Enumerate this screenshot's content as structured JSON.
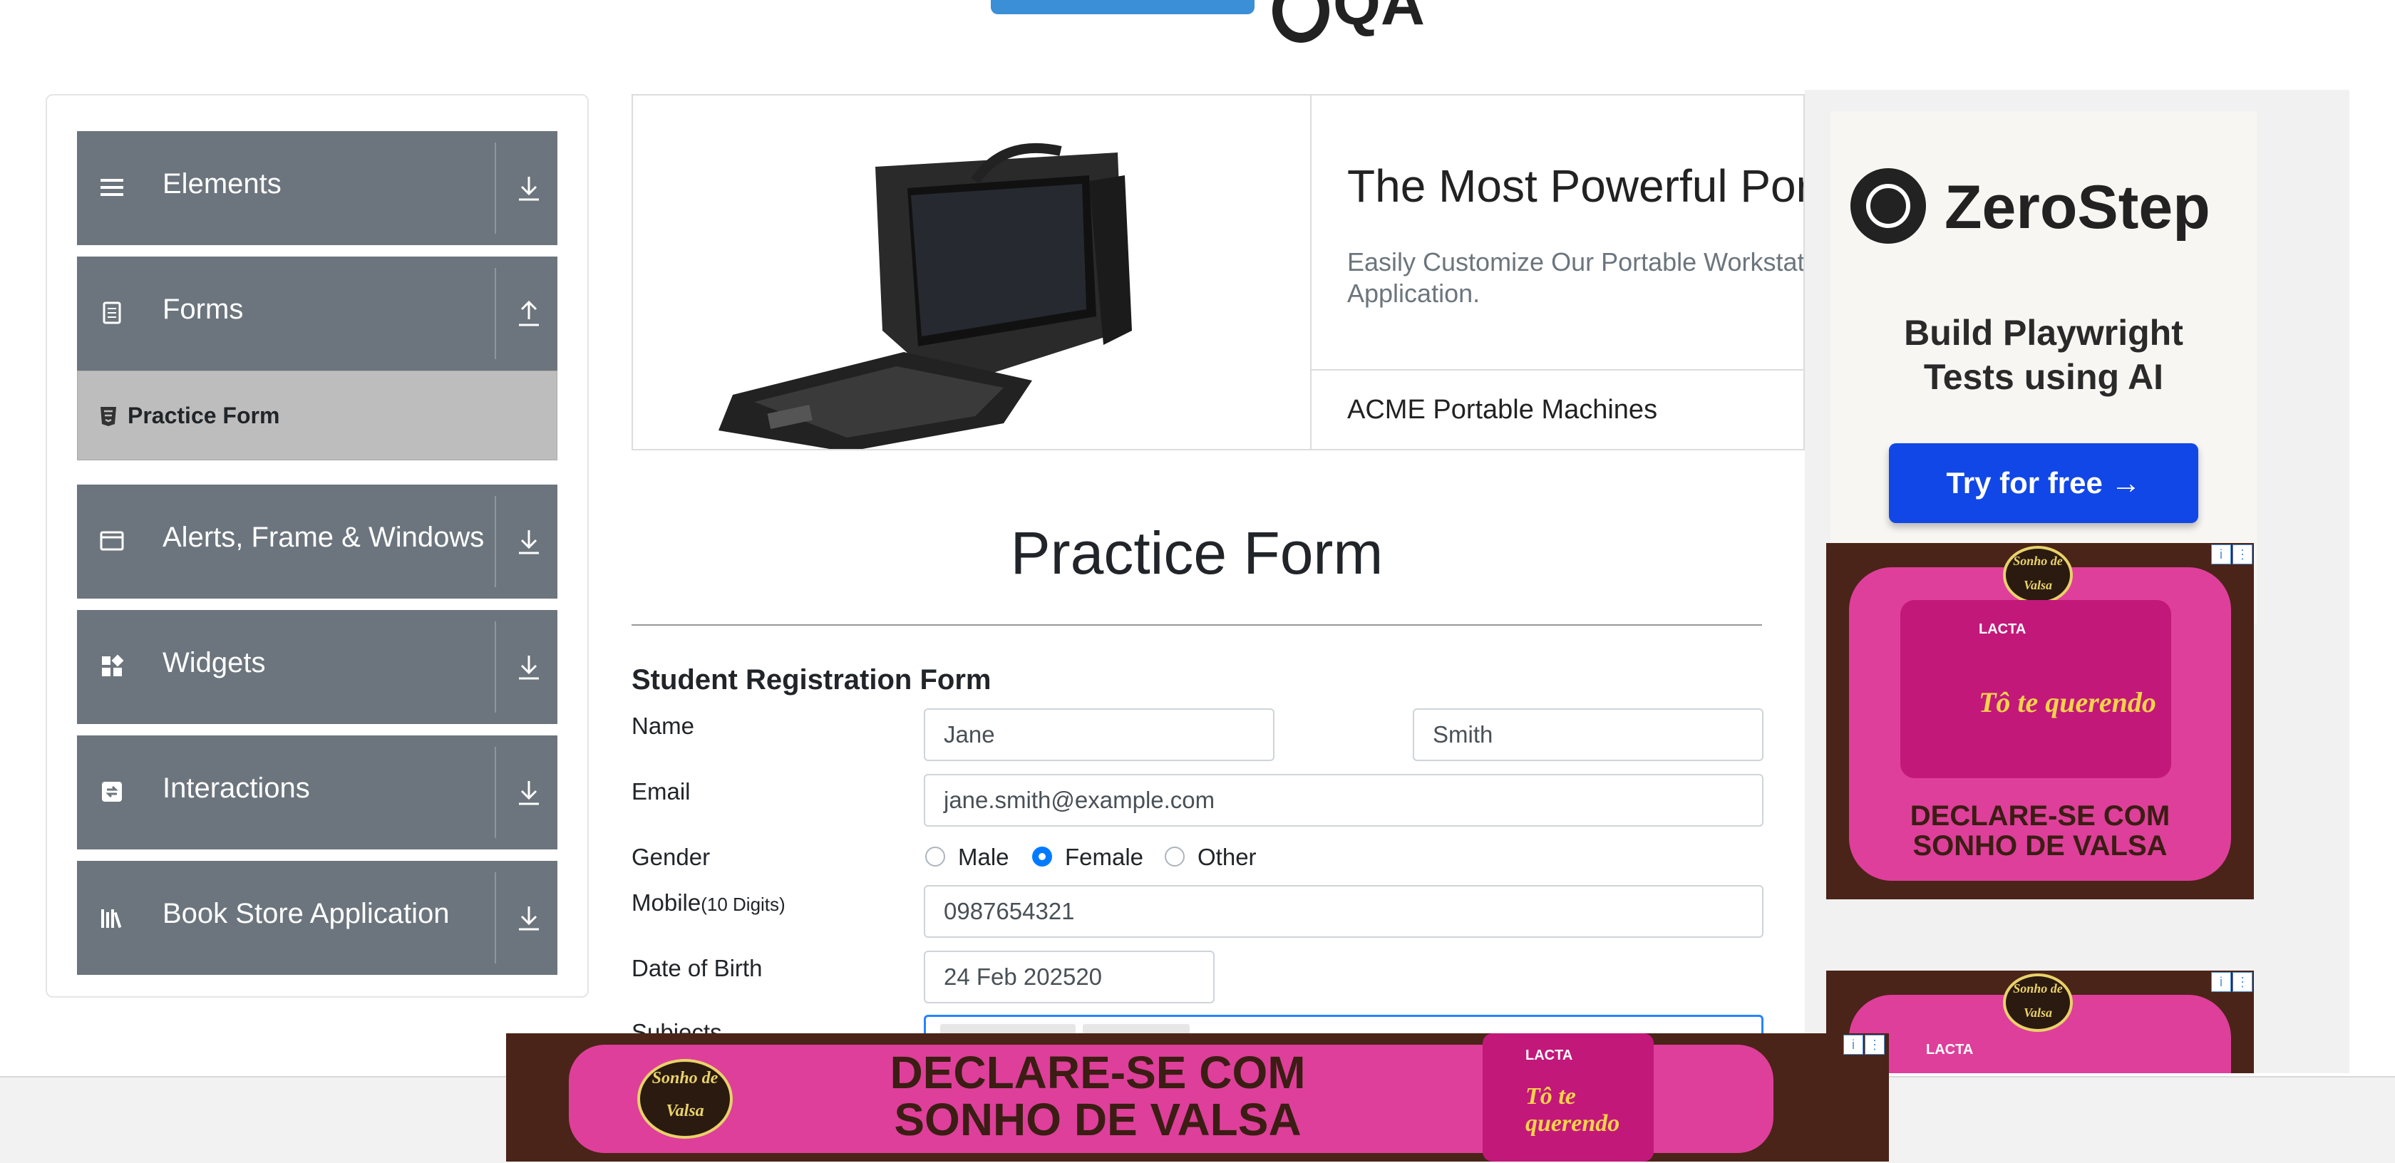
{
  "colors": {
    "sidebar_group_bg": "#6c757d",
    "active_item_bg": "#bdbdbd",
    "radio_checked": "#007bff",
    "ad_button": "#1147e6",
    "ad_pink": "#de3f9a"
  },
  "sidebar": {
    "groups": [
      {
        "label": "Elements",
        "icon": "list-icon",
        "arrow": "download-arrow-icon"
      },
      {
        "label": "Forms",
        "icon": "document-icon",
        "arrow": "upload-arrow-icon"
      },
      {
        "label": "Alerts, Frame & Windows",
        "icon": "window-icon",
        "arrow": "download-arrow-icon"
      },
      {
        "label": "Widgets",
        "icon": "widgets-icon",
        "arrow": "download-arrow-icon"
      },
      {
        "label": "Interactions",
        "icon": "sync-icon",
        "arrow": "download-arrow-icon"
      },
      {
        "label": "Book Store Application",
        "icon": "books-icon",
        "arrow": "download-arrow-icon"
      }
    ],
    "active_item": {
      "label": "Practice Form",
      "icon": "html5-icon"
    }
  },
  "banner": {
    "title": "The Most Powerful Por",
    "description": "Easily Customize Our Portable Workstat Industry Application.",
    "brand": "ACME Portable Machines"
  },
  "form": {
    "page_title": "Practice Form",
    "section_title": "Student Registration Form",
    "name_label": "Name",
    "first_name": "Jane",
    "last_name": "Smith",
    "email_label": "Email",
    "email": "jane.smith@example.com",
    "gender_label": "Gender",
    "gender_options": [
      "Male",
      "Female",
      "Other"
    ],
    "gender_selected": "Female",
    "mobile_label": "Mobile",
    "mobile_hint": "(10 Digits)",
    "mobile": "0987654321",
    "dob_label": "Date of Birth",
    "dob": "24 Feb 202520",
    "subjects_label": "Subjects"
  },
  "ads": {
    "zerostep": {
      "name": "ZeroStep",
      "line1": "Build Playwright",
      "line2": "Tests using AI",
      "button": "Try for free →"
    },
    "sonho": {
      "slogan1": "DECLARE-SE COM",
      "slogan2": "SONHO DE VALSA",
      "brand": "Sonho de Valsa",
      "product_brand": "LACTA",
      "product_name": "Tô te querendo"
    }
  }
}
